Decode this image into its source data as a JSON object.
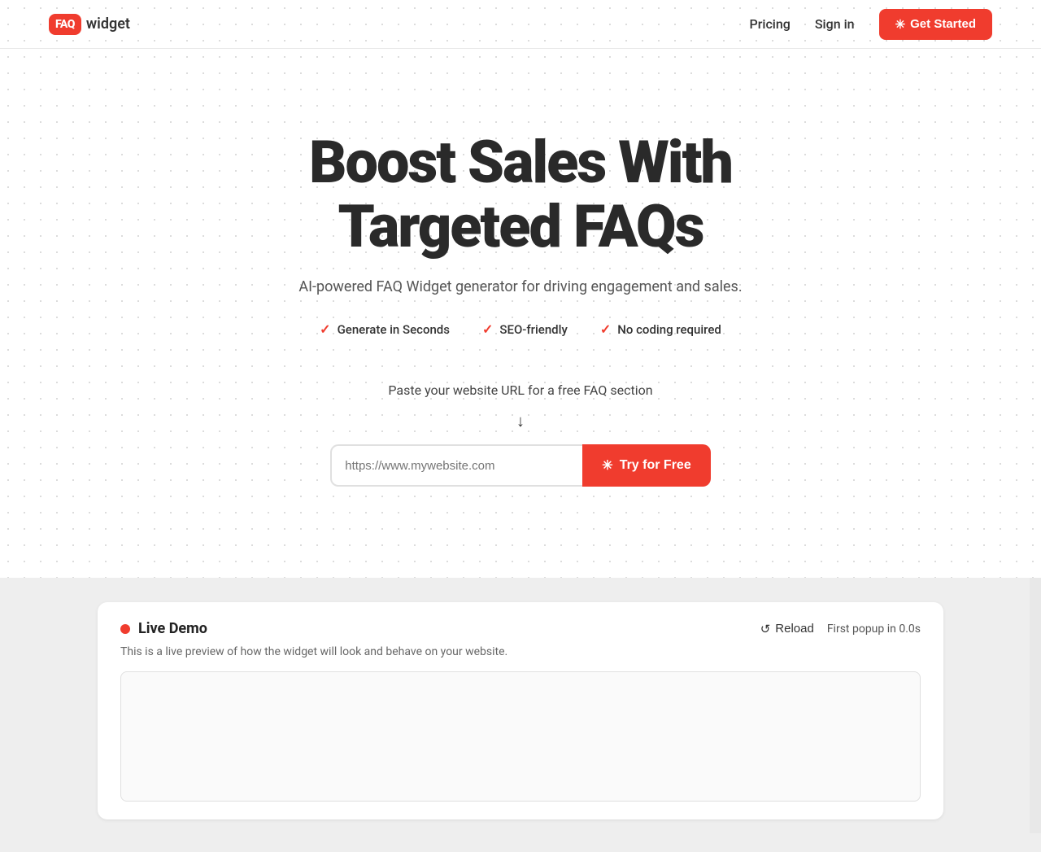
{
  "logo": {
    "box_text": "FAQ",
    "word_text": "widget"
  },
  "navbar": {
    "pricing_label": "Pricing",
    "signin_label": "Sign in",
    "get_started_label": "Get Started"
  },
  "hero": {
    "title_line1": "Boost Sales With",
    "title_line2": "Targeted FAQs",
    "subtitle": "AI-powered FAQ Widget generator for driving engagement and sales.",
    "badges": [
      {
        "label": "Generate in Seconds"
      },
      {
        "label": "SEO-friendly"
      },
      {
        "label": "No coding required"
      }
    ],
    "url_hint": "Paste your website URL for a free FAQ section",
    "url_placeholder": "https://www.mywebsite.com",
    "try_free_label": "Try for Free"
  },
  "demo": {
    "title": "Live Demo",
    "description": "This is a live preview of how the widget will look and behave on your website.",
    "reload_label": "Reload",
    "popup_timer": "First popup in 0.0s"
  },
  "icons": {
    "sparkle": "✳",
    "check": "✓",
    "arrow_down": "↓",
    "reload": "↺"
  }
}
